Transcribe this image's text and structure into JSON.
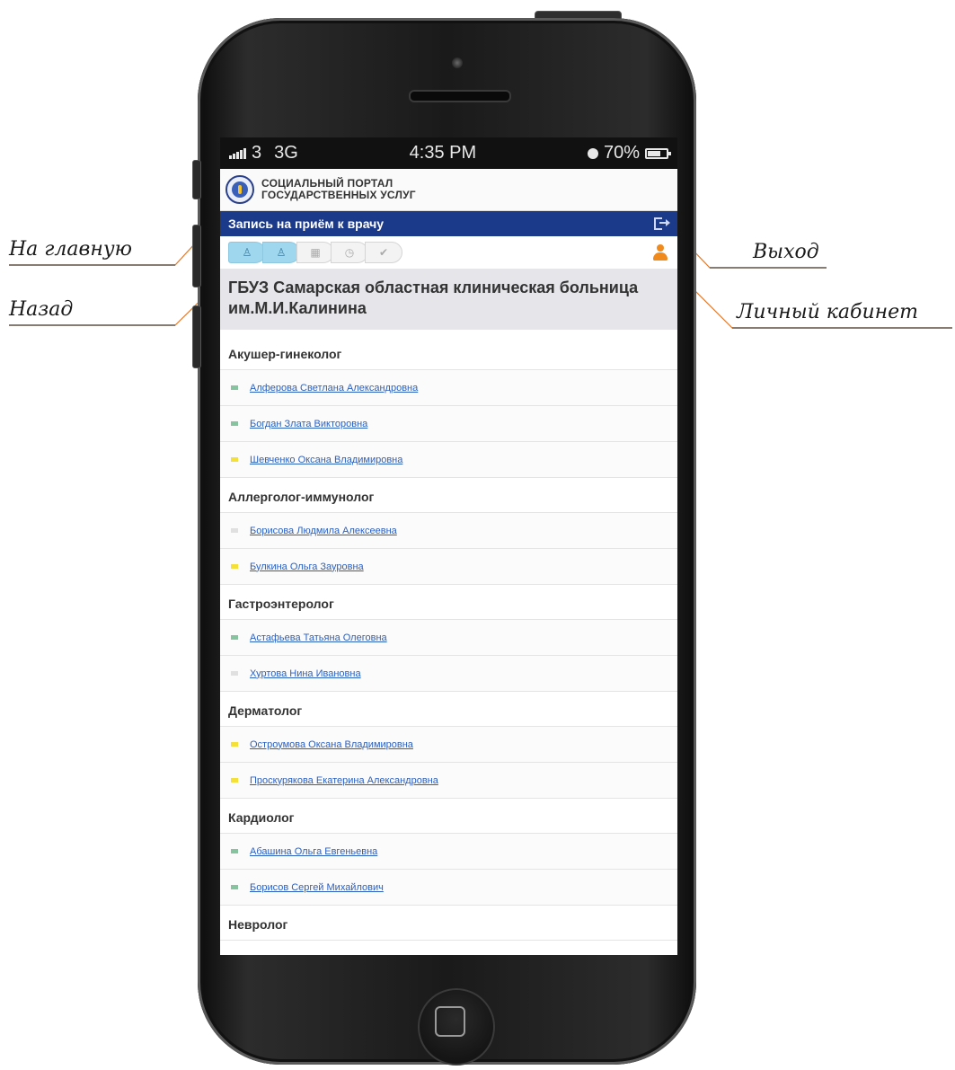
{
  "annotations": {
    "home": "На главную",
    "back": "Назад",
    "exit": "Выход",
    "cabinet": "Личный кабинет"
  },
  "status_bar": {
    "carrier": "3",
    "network": "3G",
    "time": "4:35 PM",
    "battery": "70%",
    "battery_level": 0.7
  },
  "header": {
    "portal_line1": "СОЦИАЛЬНЫЙ ПОРТАЛ",
    "portal_line2": "ГОСУДАРСТВЕННЫХ УСЛУГ",
    "logo_icon": "portal-emblem-icon"
  },
  "navbar": {
    "title": "Запись на приём к врачу",
    "exit_icon": "exit-icon"
  },
  "steps": [
    "doctor-step-icon",
    "specialist-step-icon",
    "calendar-step-icon",
    "clock-step-icon",
    "confirm-step-icon"
  ],
  "hospital": "ГБУЗ Самарская областная клиническая больница им.М.И.Калинина",
  "colors": {
    "nav_blue": "#1c3a8a",
    "green_mark": "#86c4a0",
    "yellow_mark": "#f5e03a",
    "grey_mark": "#e0e0e0",
    "link": "#2a5fc0",
    "accent_orange": "#f08a1c"
  },
  "specialties": [
    {
      "name": "Акушер-гинеколог",
      "doctors": [
        {
          "name": "Алферова Светлана Александровна",
          "status": "green"
        },
        {
          "name": "Богдан Злата Викторовна",
          "status": "green"
        },
        {
          "name": "Шевченко Оксана Владимировна",
          "status": "yellow"
        }
      ]
    },
    {
      "name": "Аллерголог-иммунолог",
      "doctors": [
        {
          "name": "Борисова Людмила Алексеевна",
          "status": "grey"
        },
        {
          "name": "Булкина Ольга Зауровна",
          "status": "yellow"
        }
      ]
    },
    {
      "name": "Гастроэнтеролог",
      "doctors": [
        {
          "name": "Астафьева Татьяна Олеговна",
          "status": "green"
        },
        {
          "name": "Хуртова Нина Ивановна",
          "status": "grey"
        }
      ]
    },
    {
      "name": "Дерматолог",
      "doctors": [
        {
          "name": "Остроумова Оксана Владимировна",
          "status": "yellow"
        },
        {
          "name": "Проскурякова Екатерина Александровна",
          "status": "yellow"
        }
      ]
    },
    {
      "name": "Кардиолог",
      "doctors": [
        {
          "name": "Абашина Ольга Евгеньевна",
          "status": "green"
        },
        {
          "name": "Борисов Сергей Михайлович",
          "status": "green"
        }
      ]
    },
    {
      "name": "Невролог",
      "doctors": []
    }
  ]
}
